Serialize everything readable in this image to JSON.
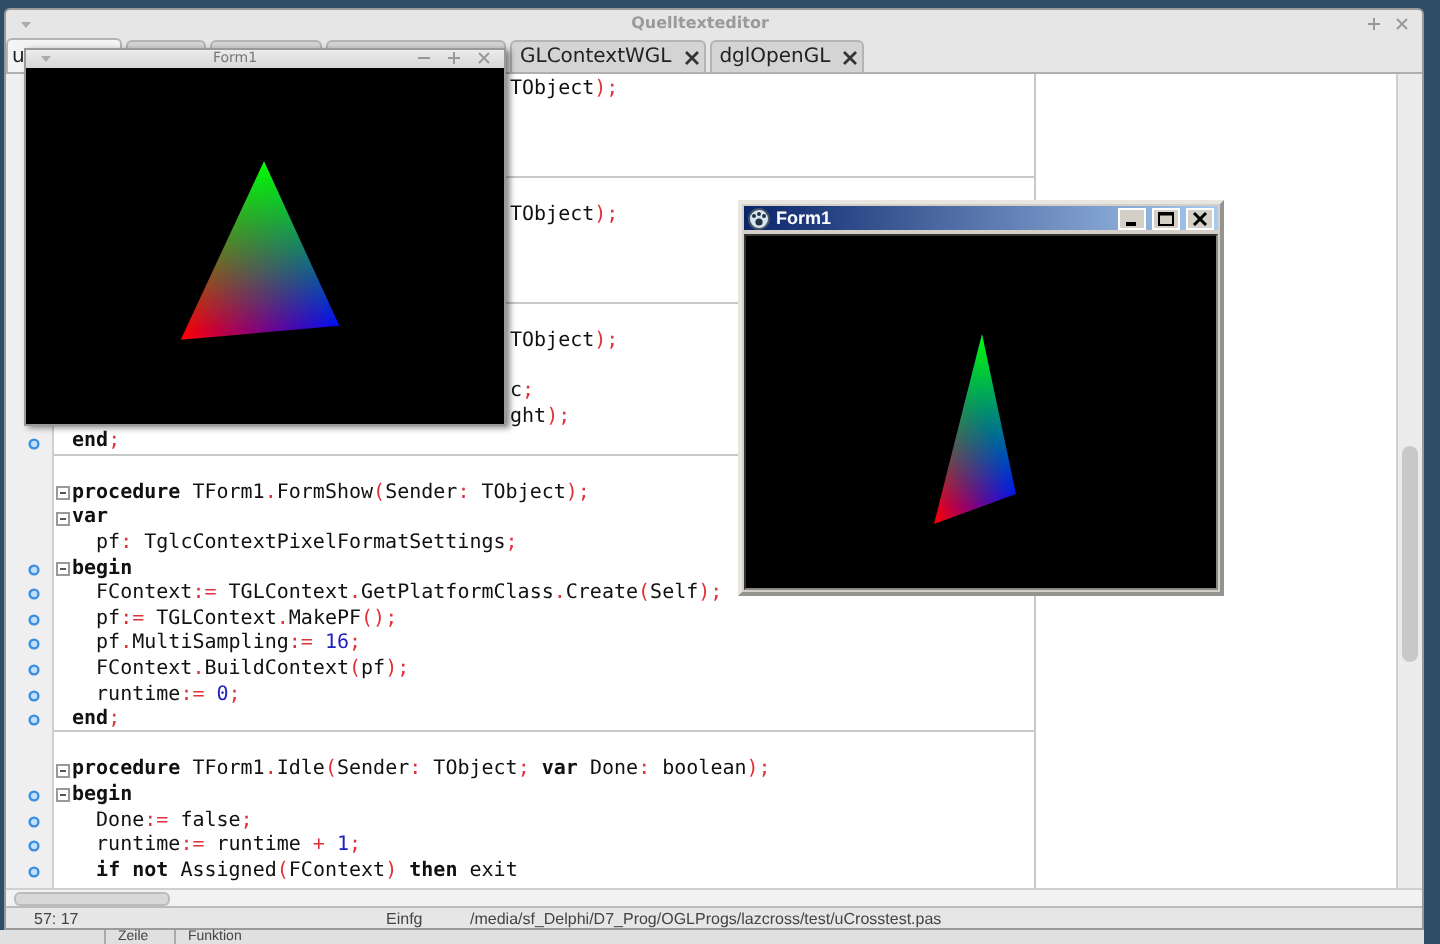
{
  "editor_window": {
    "title": "Quelltexteditor"
  },
  "tabs": [
    {
      "label": "u",
      "selected": true
    },
    {
      "selected": false
    },
    {
      "selected": false
    },
    {
      "selected": false
    },
    {
      "label": "GLContextWGL",
      "selected": false
    },
    {
      "label": "dglOpenGL",
      "selected": false
    }
  ],
  "code_lines": [
    {
      "kind": "fragment",
      "text": "TObject);"
    },
    {
      "kind": "blank"
    },
    {
      "kind": "blank"
    },
    {
      "kind": "blank",
      "divider_below": true
    },
    {
      "kind": "blank"
    },
    {
      "kind": "fragment",
      "text": "TObject);"
    },
    {
      "kind": "blank"
    },
    {
      "kind": "blank"
    },
    {
      "kind": "blank",
      "divider_below": true
    },
    {
      "kind": "blank"
    },
    {
      "kind": "fragment",
      "text": "TObject);"
    },
    {
      "kind": "blank"
    },
    {
      "kind": "fragment",
      "text": "c;"
    },
    {
      "kind": "fragment",
      "text": "ght);"
    },
    {
      "kind": "code",
      "text": "**end**;",
      "dot": true,
      "divider_below": true
    },
    {
      "kind": "blank"
    },
    {
      "kind": "code",
      "text": "**procedure** TForm1.FormShow(Sender: TObject);",
      "fold": true
    },
    {
      "kind": "code",
      "text": "**var**",
      "fold": true
    },
    {
      "kind": "code",
      "text": "  pf: TglcContextPixelFormatSettings;"
    },
    {
      "kind": "code",
      "text": "**begin**",
      "dot": true,
      "fold": true
    },
    {
      "kind": "code",
      "text": "  FContext:= TGLContext.GetPlatformClass.Create(Self);",
      "dot": true
    },
    {
      "kind": "code",
      "text": "  pf:= TGLContext.MakePF();",
      "dot": true
    },
    {
      "kind": "code",
      "text": "  pf.MultiSampling:= 16;",
      "dot": true
    },
    {
      "kind": "code",
      "text": "  FContext.BuildContext(pf);",
      "dot": true
    },
    {
      "kind": "code",
      "text": "  runtime:= 0;",
      "dot": true
    },
    {
      "kind": "code",
      "text": "**end**;",
      "dot": true,
      "divider_below": true
    },
    {
      "kind": "blank"
    },
    {
      "kind": "code",
      "text": "**procedure** TForm1.Idle(Sender: TObject; **var** Done: boolean);",
      "fold": true
    },
    {
      "kind": "code",
      "text": "**begin**",
      "dot": true,
      "fold": true
    },
    {
      "kind": "code",
      "text": "  Done:= false;",
      "dot": true
    },
    {
      "kind": "code",
      "text": "  runtime:= runtime + 1;",
      "dot": true
    },
    {
      "kind": "code",
      "text": "  **if** **not** Assigned(FContext) **then** exit",
      "dot": true
    }
  ],
  "status_bar": {
    "position": "57: 17",
    "mode": "Einfg",
    "path": "/media/sf_Delphi/D7_Prog/OGLProgs/lazcross/test/uCrosstest.pas"
  },
  "bottom_panel": {
    "columns": [
      "Zeile",
      "Funktion"
    ]
  },
  "form_windows": [
    {
      "kind": "gtk",
      "title": "Form1"
    },
    {
      "kind": "classic",
      "title": "Form1"
    }
  ]
}
